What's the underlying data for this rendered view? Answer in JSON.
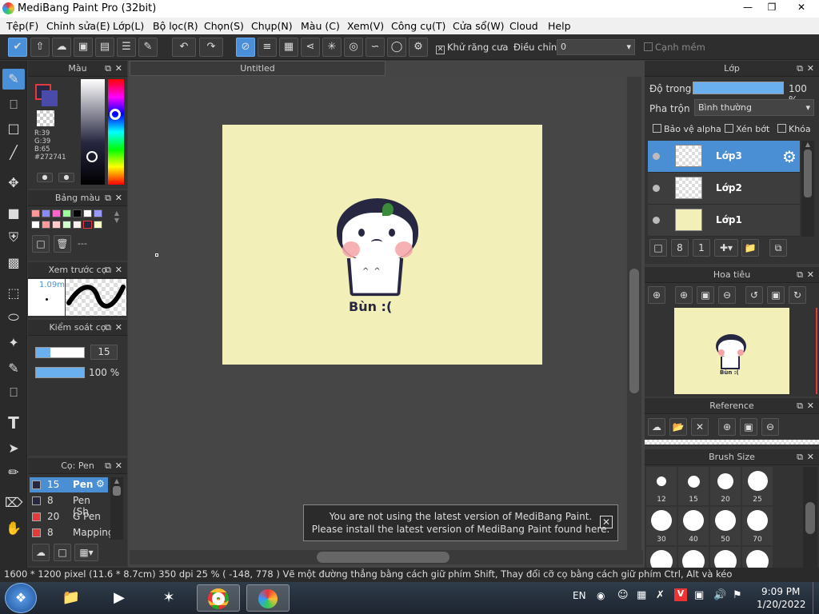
{
  "window": {
    "title": "MediBang Paint Pro (32bit)"
  },
  "menu": [
    "Tệp(F)",
    "Chỉnh sửa(E)",
    "Lớp(L)",
    "Bộ lọc(R)",
    "Chọn(S)",
    "Chụp(N)",
    "Màu (C)",
    "Xem(V)",
    "Công cụ(T)",
    "Cửa sổ(W)",
    "Cloud",
    "Help"
  ],
  "toolbar": {
    "antialias_label": "Khử răng cưa",
    "correction_label": "Điều chỉnh",
    "correction_value": "0",
    "soft_edge_label": "Cạnh mềm"
  },
  "color_panel": {
    "title": "Màu",
    "rgb": [
      "R:39",
      "G:39",
      "B:65"
    ],
    "hex": "#272741",
    "primary_color": "#272741"
  },
  "palette_panel": {
    "title": "Bảng màu",
    "name": "---"
  },
  "brush_preview_panel": {
    "title": "Xem trước cọ",
    "size": "1.09mm"
  },
  "brush_control_panel": {
    "title": "Kiểm soát cọ",
    "size_value": "15",
    "opacity_value": "100 %"
  },
  "brush_list_panel": {
    "title": "Cọ: Pen",
    "items": [
      {
        "size": "15",
        "name": "Pen",
        "color": "#272741"
      },
      {
        "size": "8",
        "name": "Pen (Sh",
        "color": "#272741"
      },
      {
        "size": "20",
        "name": "G Pen",
        "color": "#e23b3b"
      },
      {
        "size": "8",
        "name": "Mapping",
        "color": "#e23b3b"
      }
    ]
  },
  "document": {
    "tab": "Untitled",
    "caption": "Bùn :("
  },
  "notice": {
    "line1": "You are not using the latest version of MediBang Paint.",
    "line2": "Please install the latest version of MediBang Paint found here."
  },
  "layer_panel": {
    "title": "Lớp",
    "opacity_label": "Độ trong",
    "opacity_value": "100 %",
    "blend_label": "Pha trộn",
    "blend_value": "Bình thường",
    "protect_alpha": "Bảo vệ alpha",
    "clip": "Xén bớt",
    "lock": "Khóa",
    "layers": [
      "Lớp3",
      "Lớp2",
      "Lớp1"
    ]
  },
  "navigator_panel": {
    "title": "Hoa tiêu",
    "caption": "Bùn :("
  },
  "reference_panel": {
    "title": "Reference"
  },
  "brush_size_panel": {
    "title": "Brush Size",
    "sizes": [
      "12",
      "15",
      "20",
      "25",
      "30",
      "40",
      "50",
      "70"
    ]
  },
  "status": {
    "text": "1600 * 1200 pixel  (11.6 * 8.7cm)  350 dpi  25 %  ( -148, 778 )  Vẽ một đường thẳng bằng cách giữ phím Shift, Thay đổi cỡ cọ bằng cách giữ phím Ctrl, Alt và kéo"
  },
  "taskbar": {
    "language": "EN",
    "time": "9:09 PM",
    "date": "1/20/2022"
  },
  "colors": {
    "accent": "#4a90d9",
    "paper": "#f2f0b8",
    "ink": "#272741",
    "blush": "#f4a3a8"
  }
}
